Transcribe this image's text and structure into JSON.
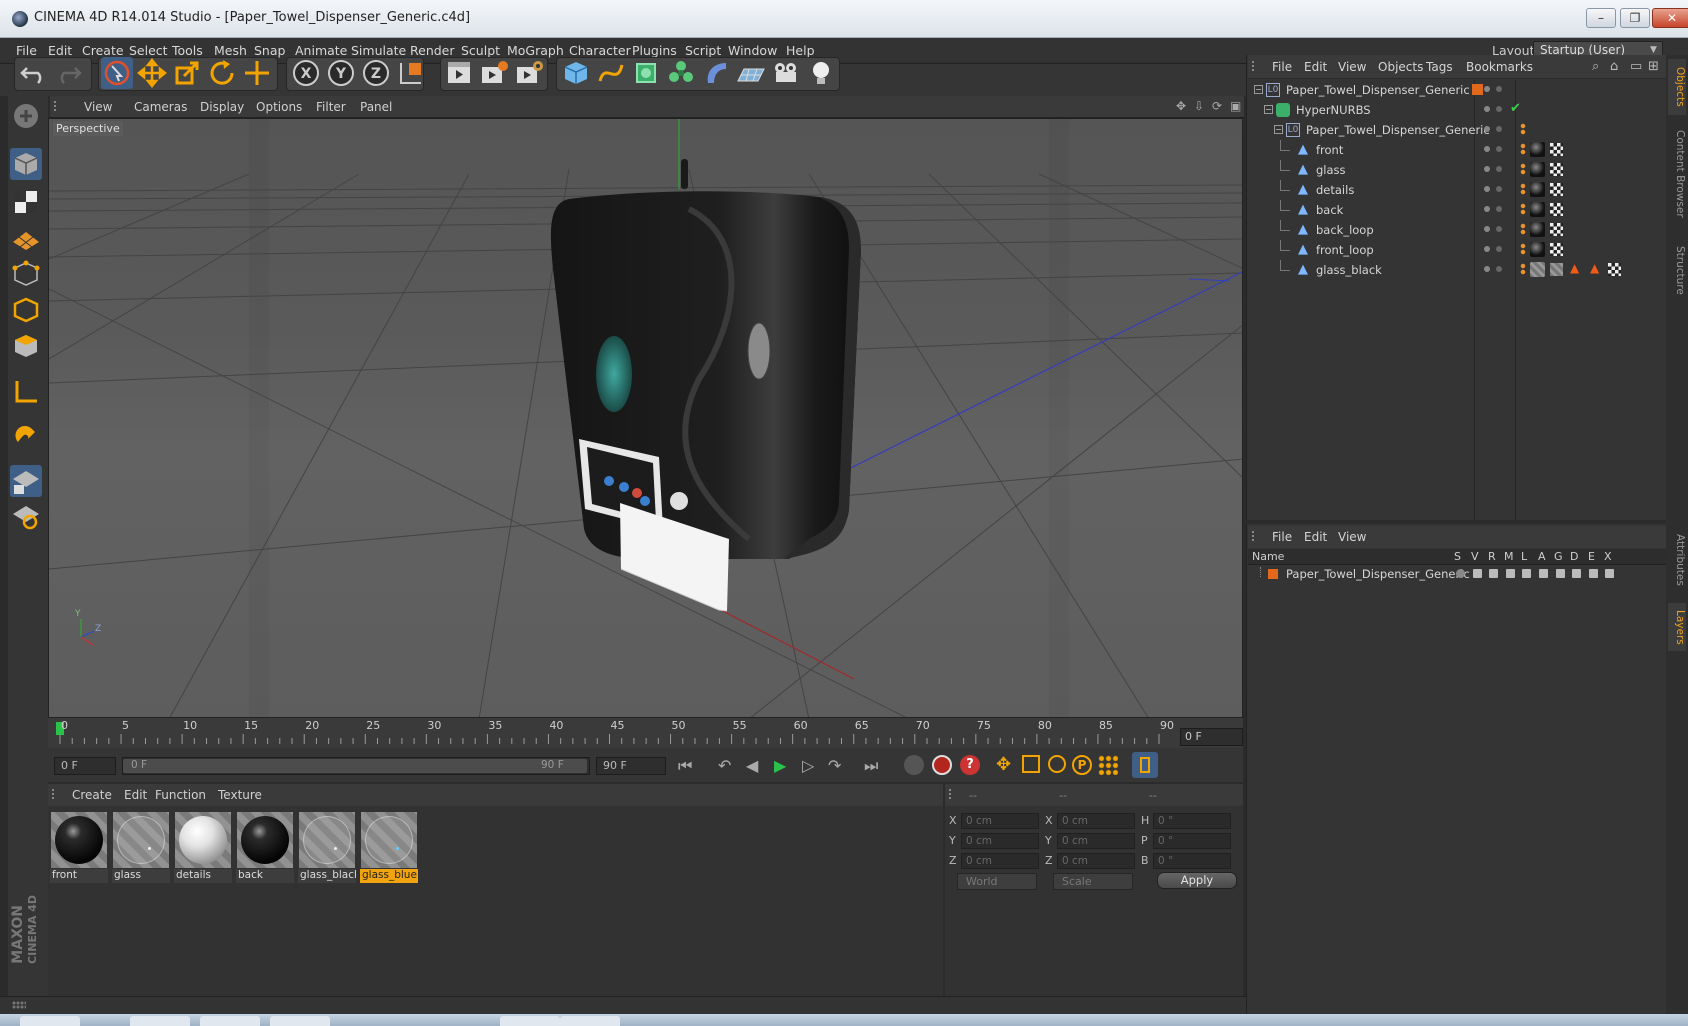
{
  "window": {
    "title": "CINEMA 4D R14.014 Studio - [Paper_Towel_Dispenser_Generic.c4d]",
    "min": "–",
    "restore": "❐",
    "close": "✕"
  },
  "menu": [
    "File",
    "Edit",
    "Create",
    "Select",
    "Tools",
    "Mesh",
    "Snap",
    "Animate",
    "Simulate",
    "Render",
    "Sculpt",
    "MoGraph",
    "Character",
    "Plugins",
    "Script",
    "Window",
    "Help"
  ],
  "layout": {
    "label": "Layout:",
    "value": "Startup (User)"
  },
  "viewport": {
    "menu": [
      "View",
      "Cameras",
      "Display",
      "Options",
      "Filter",
      "Panel"
    ],
    "camera_label": "Perspective",
    "axis_y": "Y",
    "axis_z": "Z"
  },
  "timeline": {
    "ticks": [
      "0",
      "5",
      "10",
      "15",
      "20",
      "25",
      "30",
      "35",
      "40",
      "45",
      "50",
      "55",
      "60",
      "65",
      "70",
      "75",
      "80",
      "85",
      "90"
    ],
    "current_frame_field": "0 F",
    "start_field": "0 F",
    "range_start": "0 F",
    "range_end": "90 F",
    "end_field": "90 F"
  },
  "materials": {
    "menu": [
      "Create",
      "Edit",
      "Function",
      "Texture"
    ],
    "items": [
      {
        "name": "front",
        "kind": "dark",
        "selected": false
      },
      {
        "name": "glass",
        "kind": "checker",
        "selected": false
      },
      {
        "name": "details",
        "kind": "white",
        "selected": false
      },
      {
        "name": "back",
        "kind": "dark",
        "selected": false
      },
      {
        "name": "glass_black",
        "kind": "checker",
        "selected": false
      },
      {
        "name": "glass_blue",
        "kind": "checker-blue",
        "selected": true
      }
    ]
  },
  "coordinates": {
    "headers": [
      "--",
      "--",
      "--"
    ],
    "rows": [
      {
        "l1": "X",
        "v1": "0 cm",
        "l2": "X",
        "v2": "0 cm",
        "l3": "H",
        "v3": "0 °"
      },
      {
        "l1": "Y",
        "v1": "0 cm",
        "l2": "Y",
        "v2": "0 cm",
        "l3": "P",
        "v3": "0 °"
      },
      {
        "l1": "Z",
        "v1": "0 cm",
        "l2": "Z",
        "v2": "0 cm",
        "l3": "B",
        "v3": "0 °"
      }
    ],
    "mode": "World",
    "scale": "Scale",
    "apply": "Apply"
  },
  "object_manager": {
    "menu": [
      "File",
      "Edit",
      "View",
      "Objects",
      "Tags",
      "Bookmarks"
    ],
    "objects": [
      {
        "name": "Paper_Towel_Dispenser_Generic",
        "type": "null",
        "level": 0
      },
      {
        "name": "HyperNURBS",
        "type": "hypernurbs",
        "level": 1
      },
      {
        "name": "Paper_Towel_Dispenser_Generic",
        "type": "null",
        "level": 2
      },
      {
        "name": "front",
        "type": "polygon",
        "level": 3
      },
      {
        "name": "glass",
        "type": "polygon",
        "level": 3
      },
      {
        "name": "details",
        "type": "polygon",
        "level": 3
      },
      {
        "name": "back",
        "type": "polygon",
        "level": 3
      },
      {
        "name": "back_loop",
        "type": "polygon",
        "level": 3
      },
      {
        "name": "front_loop",
        "type": "polygon",
        "level": 3
      },
      {
        "name": "glass_black",
        "type": "polygon",
        "level": 3
      }
    ]
  },
  "layers": {
    "menu": [
      "File",
      "Edit",
      "View"
    ],
    "columns": [
      "Name",
      "S",
      "V",
      "R",
      "M",
      "L",
      "A",
      "G",
      "D",
      "E",
      "X"
    ],
    "rows": [
      {
        "name": "Paper_Towel_Dispenser_Generic",
        "color": "#e2691c"
      }
    ]
  },
  "side_tabs": {
    "top": [
      "Objects",
      "Content Browser",
      "Structure"
    ],
    "bottom": [
      "Attributes",
      "Layers"
    ]
  },
  "brand": {
    "maxon": "MAXON",
    "product": "CINEMA 4D"
  },
  "colors": {
    "accent": "#f1a40f",
    "selection": "#3f5f86",
    "layer": "#e2691c"
  }
}
